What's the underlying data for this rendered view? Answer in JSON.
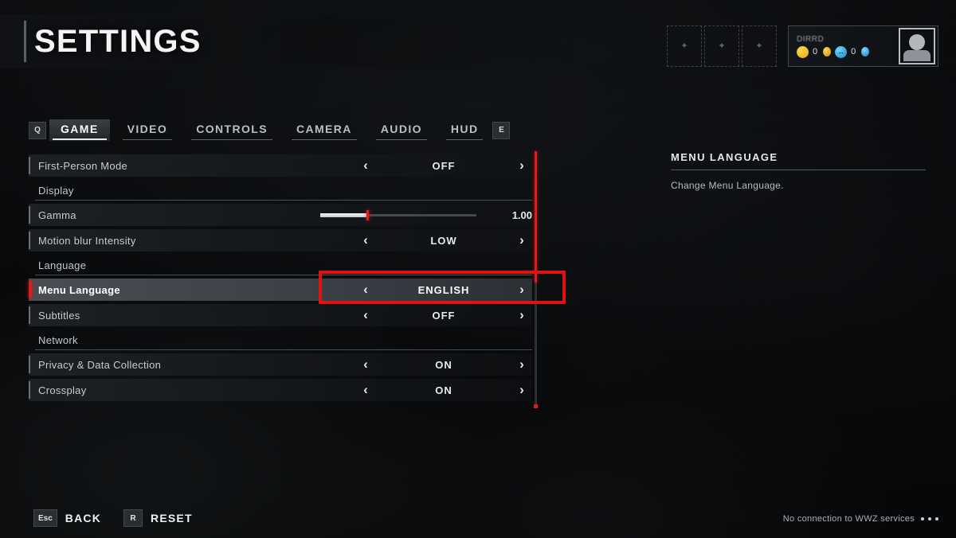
{
  "header": {
    "title": "SETTINGS"
  },
  "hud": {
    "slots": [
      {
        "name": "slot-1",
        "mark": "✦"
      },
      {
        "name": "slot-2",
        "mark": "✦"
      },
      {
        "name": "slot-3",
        "mark": "✦"
      }
    ],
    "player": {
      "name": "DIRRD",
      "currencies": [
        {
          "icon": "gold-coin-icon",
          "value": "0"
        },
        {
          "icon": "blue-token-icon",
          "value": "0"
        }
      ]
    },
    "avatar_icon": "player-avatar-icon"
  },
  "tabs": {
    "prev_key": "Q",
    "next_key": "E",
    "items": [
      {
        "label": "GAME",
        "active": true
      },
      {
        "label": "VIDEO",
        "active": false
      },
      {
        "label": "CONTROLS",
        "active": false
      },
      {
        "label": "CAMERA",
        "active": false
      },
      {
        "label": "AUDIO",
        "active": false
      },
      {
        "label": "HUD",
        "active": false
      }
    ]
  },
  "settings": {
    "rows": [
      {
        "type": "option",
        "label": "First-Person Mode",
        "value": "OFF",
        "selected": false
      },
      {
        "type": "section",
        "label": "Display"
      },
      {
        "type": "slider",
        "label": "Gamma",
        "value": "1.00",
        "fill_percent": 30,
        "selected": false
      },
      {
        "type": "option",
        "label": "Motion blur Intensity",
        "value": "LOW",
        "selected": false
      },
      {
        "type": "section",
        "label": "Language"
      },
      {
        "type": "option",
        "label": "Menu Language",
        "value": "ENGLISH",
        "selected": true
      },
      {
        "type": "option",
        "label": "Subtitles",
        "value": "OFF",
        "selected": false
      },
      {
        "type": "section",
        "label": "Network"
      },
      {
        "type": "option",
        "label": "Privacy & Data Collection",
        "value": "ON",
        "selected": false
      },
      {
        "type": "option",
        "label": "Crossplay",
        "value": "ON",
        "selected": false
      }
    ],
    "left_arrow": "‹",
    "right_arrow": "›"
  },
  "info_panel": {
    "title": "MENU LANGUAGE",
    "description": "Change Menu Language."
  },
  "footer": {
    "actions": [
      {
        "key": "Esc",
        "label": "BACK"
      },
      {
        "key": "R",
        "label": "RESET"
      }
    ],
    "status": "No connection to WWZ services"
  },
  "colors": {
    "accent_red": "#e01212",
    "selected_red": "#d81d1d",
    "gold": "#ffd84d",
    "blue": "#6fd6ff"
  }
}
